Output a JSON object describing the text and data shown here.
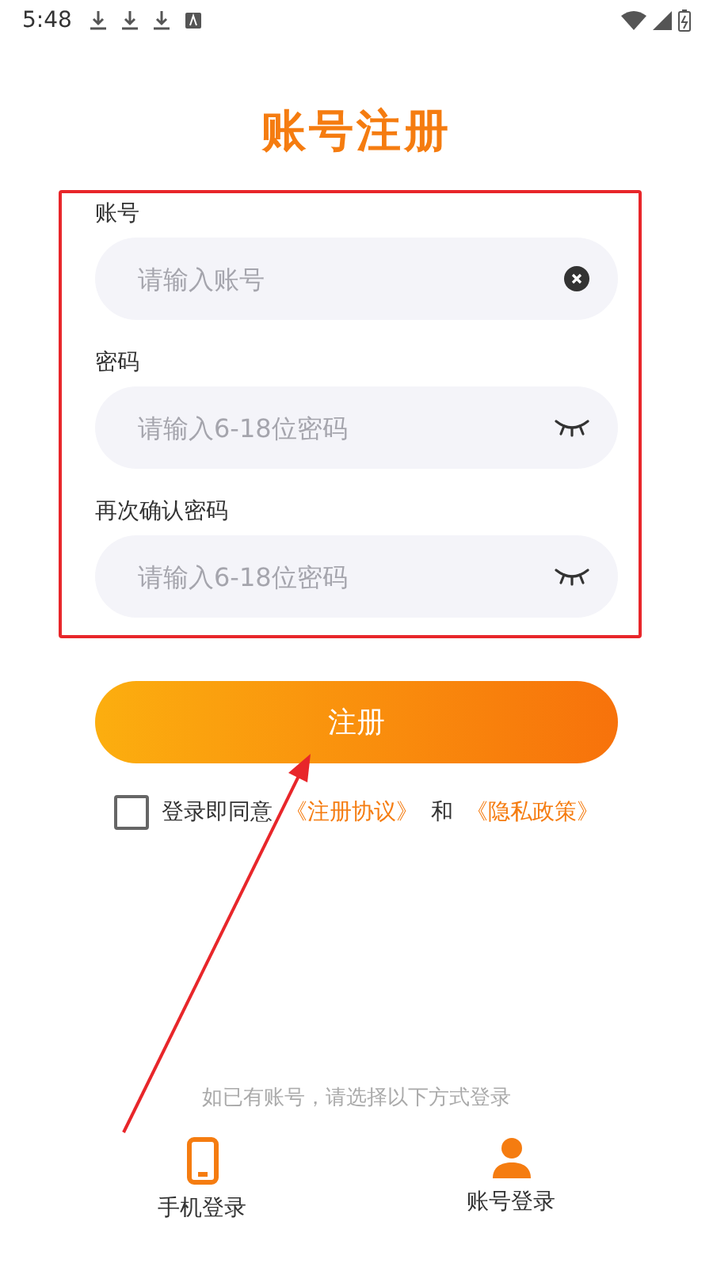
{
  "status_bar": {
    "time": "5:48"
  },
  "title": "账号注册",
  "fields": [
    {
      "label": "账号",
      "placeholder": "请输入账号",
      "kind": "clear"
    },
    {
      "label": "密码",
      "placeholder": "请输入6-18位密码",
      "kind": "eye"
    },
    {
      "label": "再次确认密码",
      "placeholder": "请输入6-18位密码",
      "kind": "eye"
    }
  ],
  "submit_button": "注册",
  "agreement": {
    "checked": false,
    "text": "登录即同意",
    "link_1": "《注册协议》",
    "joiner": "和",
    "link_2": "《隐私政策》"
  },
  "login_hint": "如已有账号，请选择以下方式登录",
  "login_options": [
    {
      "label": "手机登录",
      "kind": "phone"
    },
    {
      "label": "账号登录",
      "kind": "person"
    }
  ]
}
